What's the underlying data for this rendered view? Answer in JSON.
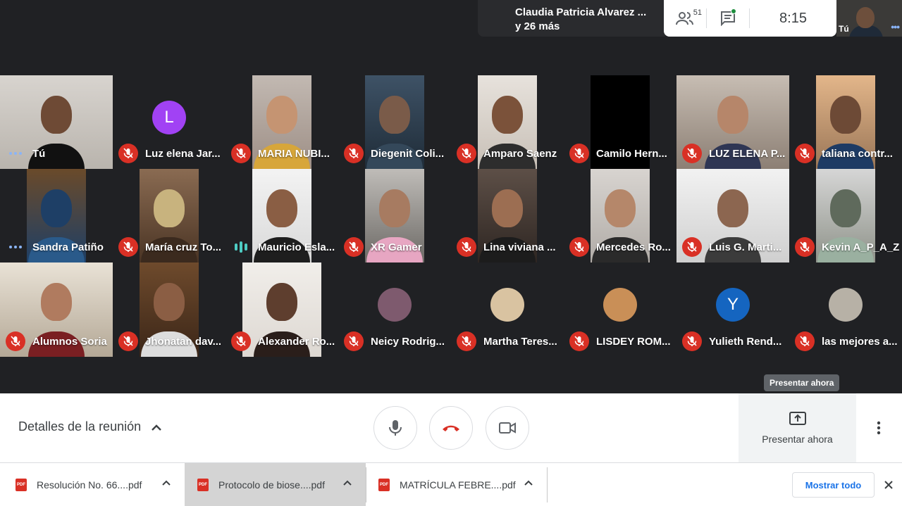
{
  "header": {
    "banner_line1": "Claudia Patricia Alvarez ...",
    "banner_line2": "y 26 más",
    "participant_count": "51",
    "clock": "8:15",
    "self_label": "Tú"
  },
  "tiles": [
    {
      "name": "Tú",
      "state": "speaking"
    },
    {
      "name": "Luz elena Jar...",
      "state": "muted",
      "avatar_letter": "L",
      "avatar_color": "#a142f4"
    },
    {
      "name": "MARIA NUBI...",
      "state": "muted"
    },
    {
      "name": "Diegenit Coli...",
      "state": "muted"
    },
    {
      "name": "Amparo Saenz",
      "state": "muted"
    },
    {
      "name": "Camilo Hern...",
      "state": "muted"
    },
    {
      "name": "LUZ ELENA P...",
      "state": "muted"
    },
    {
      "name": "taliana contr...",
      "state": "muted"
    },
    {
      "name": "Sandra Patiño",
      "state": "speaking"
    },
    {
      "name": "María cruz To...",
      "state": "muted"
    },
    {
      "name": "Mauricio Esla...",
      "state": "talking"
    },
    {
      "name": "XR Gamer",
      "state": "muted"
    },
    {
      "name": "Lina viviana ...",
      "state": "muted"
    },
    {
      "name": "Mercedes Ro...",
      "state": "muted"
    },
    {
      "name": "Luis G. Marti...",
      "state": "muted"
    },
    {
      "name": "Kevin A_P_A_Z",
      "state": "muted"
    },
    {
      "name": "Alumnos Soria",
      "state": "muted"
    },
    {
      "name": "Jhonatan dav...",
      "state": "muted"
    },
    {
      "name": "Alexander Ro...",
      "state": "muted"
    },
    {
      "name": "Neicy Rodrig...",
      "state": "muted"
    },
    {
      "name": "Martha Teres...",
      "state": "muted"
    },
    {
      "name": "LISDEY ROM...",
      "state": "muted"
    },
    {
      "name": "Yulieth Rend...",
      "state": "muted",
      "avatar_letter": "Y",
      "avatar_color": "#1565c0"
    },
    {
      "name": "las mejores a...",
      "state": "muted"
    }
  ],
  "controls": {
    "details_label": "Detalles de la reunión",
    "present_label": "Presentar ahora",
    "tooltip": "Presentar ahora",
    "mic_icon": "mic-icon",
    "hangup_icon": "hang-up-icon",
    "camera_icon": "camera-icon"
  },
  "downloads": {
    "items": [
      {
        "file": "Resolución No. 66....pdf"
      },
      {
        "file": "Protocolo de biose....pdf"
      },
      {
        "file": "MATRÍCULA FEBRE....pdf"
      }
    ],
    "show_all": "Mostrar todo",
    "pdf_badge": "PDF"
  },
  "colors": {
    "mute_red": "#d93025",
    "accent_blue": "#1a73e8",
    "dark_bg": "#202124"
  }
}
